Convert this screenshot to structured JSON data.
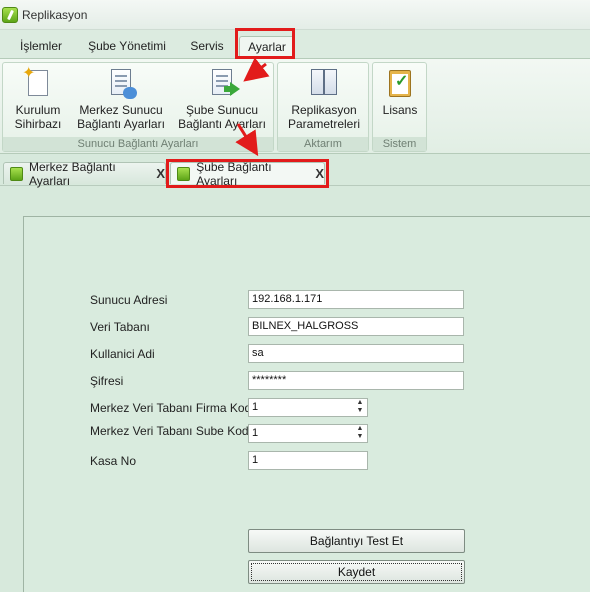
{
  "window": {
    "title": "Replikasyon"
  },
  "ribbon_tabs": [
    {
      "label": "İşlemler"
    },
    {
      "label": "Şube Yönetimi"
    },
    {
      "label": "Servis"
    },
    {
      "label": "Ayarlar",
      "active": true
    }
  ],
  "ribbon_groups": [
    {
      "label": "Sunucu Bağlantı Ayarları",
      "buttons": [
        {
          "line1": "Kurulum",
          "line2": "Sihirbazı",
          "icon": "wizard-icon"
        },
        {
          "line1": "Merkez Sunucu",
          "line2": "Bağlantı Ayarları",
          "icon": "server-doc-icon"
        },
        {
          "line1": "Şube Sunucu",
          "line2": "Bağlantı Ayarları",
          "icon": "branch-doc-icon"
        }
      ]
    },
    {
      "label": "Aktarım",
      "buttons": [
        {
          "line1": "Replikasyon",
          "line2": "Parametreleri",
          "icon": "books-icon"
        }
      ]
    },
    {
      "label": "Sistem",
      "buttons": [
        {
          "line1": "Lisans",
          "line2": "",
          "icon": "clipboard-check-icon"
        }
      ]
    }
  ],
  "doc_tabs": [
    {
      "label": "Merkez Bağlantı Ayarları",
      "close": "X"
    },
    {
      "label": "Şube Bağlantı Ayarları",
      "close": "X",
      "active": true
    }
  ],
  "form": {
    "server_address": {
      "label": "Sunucu Adresi",
      "value": "192.168.1.171"
    },
    "database": {
      "label": "Veri Tabanı",
      "value": "BILNEX_HALGROSS"
    },
    "username": {
      "label": "Kullanici Adi",
      "value": "sa"
    },
    "password": {
      "label": "Şifresi",
      "value": "********"
    },
    "hq_firm_code": {
      "label": "Merkez Veri Tabanı Firma Kodu",
      "value": "1"
    },
    "hq_branch_code": {
      "label": "Merkez Veri Tabanı Sube Kodu",
      "value": "1"
    },
    "register_no": {
      "label": "Kasa No",
      "value": "1"
    },
    "test_button": "Bağlantıyı Test Et",
    "save_button": "Kaydet"
  },
  "colors": {
    "highlight": "#e21b1b",
    "accent": "#5da518"
  }
}
